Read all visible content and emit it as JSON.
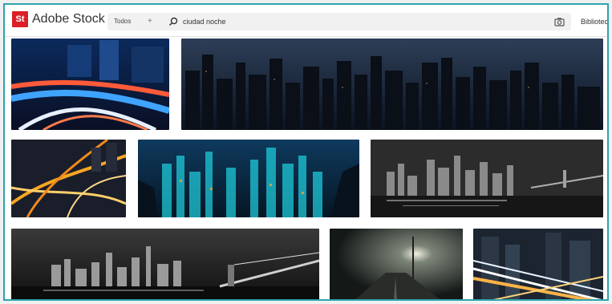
{
  "app": {
    "logo_text": "St",
    "title": "Adobe Stock"
  },
  "search": {
    "scope": "Todos",
    "scope_arrow": "+",
    "query": "ciudad noche"
  },
  "header": {
    "libraries_label": "Bibliotecas"
  },
  "results": [
    {
      "id": "light-trails-highway"
    },
    {
      "id": "city-skyline-panorama"
    },
    {
      "id": "highway-interchange-aerial"
    },
    {
      "id": "hong-kong-night"
    },
    {
      "id": "manhattan-skyline-monochrome"
    },
    {
      "id": "brooklyn-bridge-night"
    },
    {
      "id": "foggy-street-lamp"
    },
    {
      "id": "skyscraper-light-streaks"
    }
  ]
}
